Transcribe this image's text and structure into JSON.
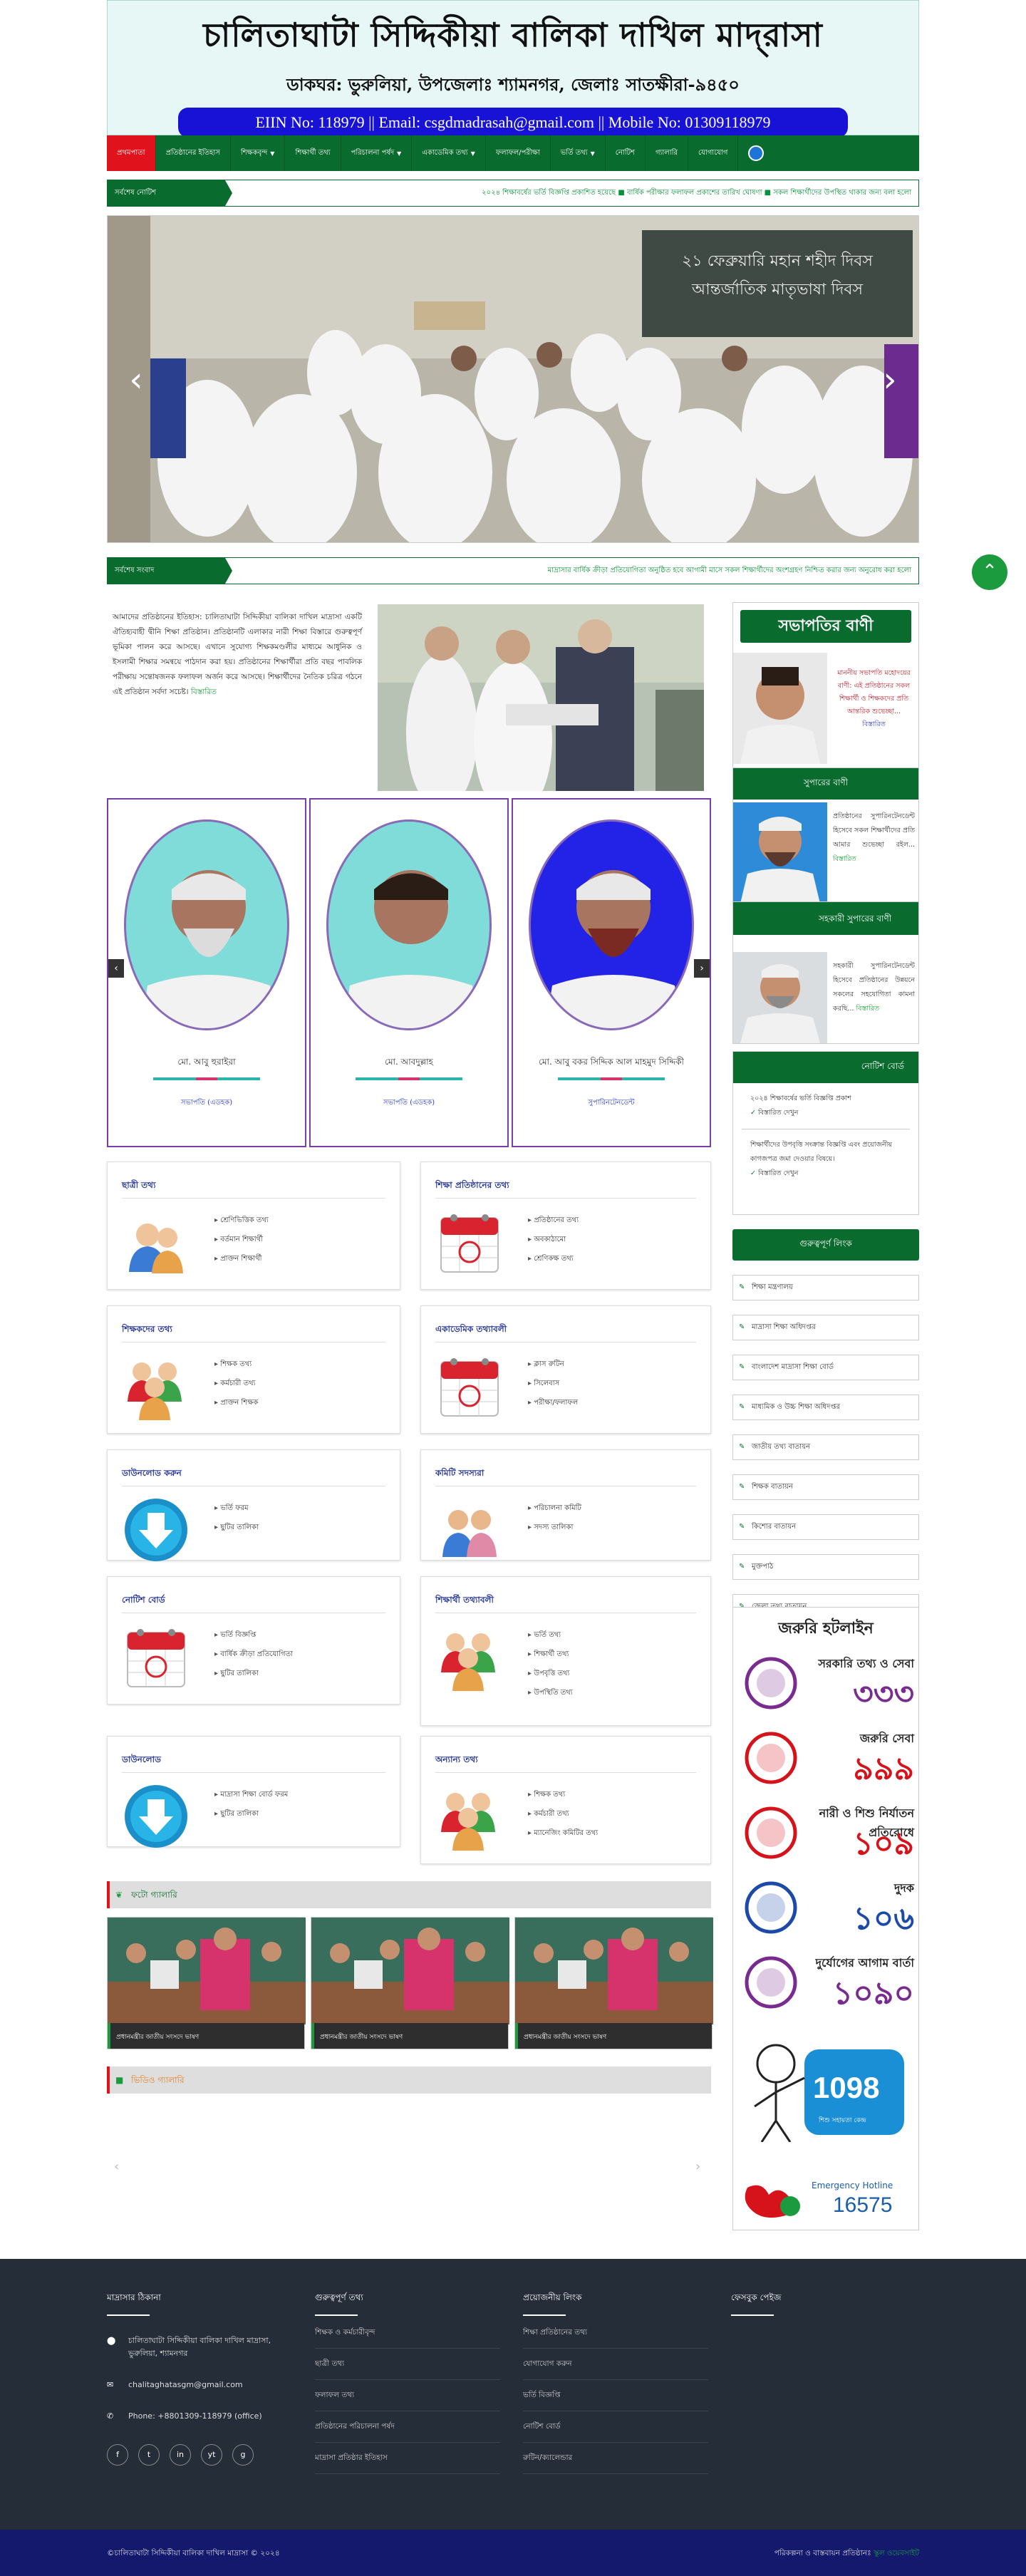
{
  "header": {
    "title": "চালিতাঘাটা সিদ্দিকীয়া বালিকা দাখিল মাদ্‌রাসা",
    "address": "ডাকঘর: ভুরুলিয়া, উপজেলাঃ শ্যামনগর, জেলাঃ সাতক্ষীরা-৯৪৫০",
    "contact": "EIIN No: 118979 || Email: csgdmadrasah@gmail.com || Mobile No: 01309118979"
  },
  "nav": {
    "items": [
      {
        "label": "প্রথমপাতা",
        "active": true,
        "caret": false
      },
      {
        "label": "প্রতিষ্ঠানের ইতিহাস",
        "active": false,
        "caret": false
      },
      {
        "label": "শিক্ষকবৃন্দ",
        "active": false,
        "caret": true
      },
      {
        "label": "শিক্ষার্থী তথ্য",
        "active": false,
        "caret": false
      },
      {
        "label": "পরিচালনা পর্ষদ",
        "active": false,
        "caret": true
      },
      {
        "label": "একাডেমিক তথ্য",
        "active": false,
        "caret": true
      },
      {
        "label": "ফলাফল/পরীক্ষা",
        "active": false,
        "caret": false
      },
      {
        "label": "ভর্তি তথ্য",
        "active": false,
        "caret": true
      },
      {
        "label": "নোটিশ",
        "active": false,
        "caret": false
      },
      {
        "label": "গ্যালারি",
        "active": false,
        "caret": false
      },
      {
        "label": "যোগাযোগ",
        "active": false,
        "caret": false
      }
    ]
  },
  "ticker1": {
    "label": "সর্বশেষ নোটিশ",
    "text": "২০২৪ শিক্ষাবর্ষের ভর্তি বিজ্ঞপ্তি প্রকাশিত হয়েছে ■ বার্ষিক পরীক্ষার ফলাফল প্রকাশের তারিখ ঘোষণা ■ সকল শিক্ষার্থীদের উপস্থিত থাকার জন্য বলা হলো"
  },
  "slider": {
    "banner_line1": "২১ ফেব্রুয়ারি মহান শহীদ দিবস",
    "banner_line2": "আন্তর্জাতিক মাতৃভাষা দিবস"
  },
  "ticker2": {
    "label": "সর্বশেষ সংবাদ",
    "text": "মাদ্রাসার বার্ষিক ক্রীড়া প্রতিযোগিতা অনুষ্ঠিত হবে আগামী মাসে সকল শিক্ষার্থীদের অংশগ্রহণ নিশ্চিত করার জন্য অনুরোধ করা হলো"
  },
  "about": {
    "text": "আমাদের প্রতিষ্ঠানের ইতিহাস: চালিতাঘাটা সিদ্দিকীয়া বালিকা দাখিল মাদ্রাসা একটি ঐতিহ্যবাহী দ্বীনি শিক্ষা প্রতিষ্ঠান। প্রতিষ্ঠানটি এলাকার নারী শিক্ষা বিস্তারে গুরুত্বপূর্ণ ভূমিকা পালন করে আসছে। এখানে সুযোগ্য শিক্ষকমণ্ডলীর মাধ্যমে আধুনিক ও ইসলামী শিক্ষার সমন্বয়ে পাঠদান করা হয়। প্রতিষ্ঠানের শিক্ষার্থীরা প্রতি বছর পাবলিক পরীক্ষায় সন্তোষজনক ফলাফল অর্জন করে আসছে। শিক্ষার্থীদের নৈতিক চরিত্র গঠনে এই প্রতিষ্ঠান সর্বদা সচেষ্ট।",
    "more": "বিস্তারিত"
  },
  "staff": [
    {
      "name": "মো. আবু হুরাইরা",
      "role": "সভাপতি (এডহক)",
      "bg": "#7fdcd8"
    },
    {
      "name": "মো. আবদুল্লাহ",
      "role": "সভাপতি (এডহক)",
      "bg": "#7fdcd8"
    },
    {
      "name": "মো. আবু বকর সিদ্দিক আল মাহমুদ সিদ্দিকী",
      "role": "সুপারিনটেনডেন্ট",
      "bg": "#2323e8"
    }
  ],
  "boxes": [
    {
      "title": "ছাত্রী তথ্য",
      "icon": "users-icon",
      "items": [
        "শ্রেণিভিত্তিক তথ্য",
        "বর্তমান শিক্ষার্থী",
        "প্রাক্তন শিক্ষার্থী"
      ]
    },
    {
      "title": "শিক্ষা প্রতিষ্ঠানের তথ্য",
      "icon": "calendar-icon",
      "items": [
        "প্রতিষ্ঠানের তথ্য",
        "অবকাঠামো",
        "শ্রেণিকক্ষ তথ্য"
      ]
    },
    {
      "title": "শিক্ষকদের তথ্য",
      "icon": "group-icon",
      "items": [
        "শিক্ষক তথ্য",
        "কর্মচারী তথ্য",
        "প্রাক্তন শিক্ষক"
      ]
    },
    {
      "title": "একাডেমিক তথ্যাবলী",
      "icon": "calendar-icon",
      "items": [
        "ক্লাস রুটিন",
        "সিলেবাস",
        "পরীক্ষা/ফলাফল"
      ]
    },
    {
      "title": "ডাউনলোড করুন",
      "icon": "download-icon",
      "items": [
        "ভর্তি ফরম",
        "ছুটির তালিকা"
      ]
    },
    {
      "title": "কমিটি সদস্যরা",
      "icon": "pair-icon",
      "items": [
        "পরিচালনা কমিটি",
        "সদস্য তালিকা"
      ]
    },
    {
      "title": "নোটিশ বোর্ড",
      "icon": "calendar-icon",
      "items": [
        "ভর্তি বিজ্ঞপ্তি",
        "বার্ষিক ক্রীড়া প্রতিযোগিতা",
        "ছুটির তালিকা"
      ]
    },
    {
      "title": "শিক্ষার্থী তথ্যাবলী",
      "icon": "group-icon",
      "items": [
        "ভর্তি তথ্য",
        "শিক্ষার্থী তথ্য",
        "উপবৃত্তি তথ্য",
        "উপস্থিতি তথ্য"
      ]
    },
    {
      "title": "ডাউনলোড",
      "icon": "download-icon",
      "items": [
        "মাদ্রাসা শিক্ষা বোর্ড ফরম",
        "ছুটির তালিকা"
      ]
    },
    {
      "title": "অন্যান্য তথ্য",
      "icon": "group-icon",
      "items": [
        "শিক্ষক তথ্য",
        "কর্মচারী তথ্য",
        "ম্যানেজিং কমিটির তথ্য"
      ]
    }
  ],
  "sidebar": {
    "message_title": "সভাপতির বাণী",
    "message_text": "মাননীয় সভাপতি মহোদয়ের বাণী: এই প্রতিষ্ঠানের সকল শিক্ষার্থী ও শিক্ষকদের প্রতি আন্তরিক শুভেচ্ছা...",
    "message_more": "বিস্তারিত",
    "head2": "সুপারের বাণী",
    "text2": "প্রতিষ্ঠানের সুপারিনটেনডেন্ট হিসেবে সকল শিক্ষার্থীদের প্রতি আমার শুভেচ্ছা রইল...",
    "more2": "বিস্তারিত",
    "head3": "সহকারী সুপারের বাণী",
    "text3": "সহকারী সুপারিনটেনডেন্ট হিসেবে প্রতিষ্ঠানের উন্নয়নে সকলের সহযোগিতা কামনা করছি...",
    "more3": "বিস্তারিত",
    "notice_head": "নোটিশ বোর্ড",
    "notice1": "২০২৪ শিক্ষাবর্ষের ভর্তি বিজ্ঞপ্তি প্রকাশ",
    "notice2": "শিক্ষার্থীদের উপবৃত্তি সংক্রান্ত বিজ্ঞপ্তি এবং প্রয়োজনীয় কাগজপত্র জমা দেওয়ার বিষয়ে।",
    "notice_tag1": "বিস্তারিত দেখুন",
    "notice_tag2": "বিস্তারিত দেখুন",
    "links_head": "গুরুত্বপূর্ণ লিংক",
    "links": [
      "শিক্ষা মন্ত্রণালয়",
      "মাদ্রাসা শিক্ষা অধিদপ্তর",
      "বাংলাদেশ মাদ্রাসা শিক্ষা বোর্ড",
      "মাধ্যমিক ও উচ্চ শিক্ষা অধিদপ্তর",
      "জাতীয় তথ্য বাতায়ন",
      "শিক্ষক বাতায়ন",
      "কিশোর বাতায়ন",
      "মুক্তপাঠ",
      "জেলা তথ্য বাতায়ন"
    ],
    "hotline_head": "জরুরি হটলাইন",
    "hotlines": [
      {
        "num": "৩৩৩",
        "label": "সরকারি তথ্য ও সেবা",
        "color": "#7a2b8f"
      },
      {
        "num": "৯৯৯",
        "label": "জরুরি সেবা",
        "color": "#d6121b"
      },
      {
        "num": "১০৯",
        "label": "নারী ও শিশু নির্যাতন প্রতিরোধে",
        "color": "#d6121b"
      },
      {
        "num": "১০৬",
        "label": "দুদক",
        "color": "#1d4aa8"
      },
      {
        "num": "১০৯০",
        "label": "দুর্যোগের আগাম বার্তা",
        "color": "#7a2b8f"
      }
    ],
    "child_help": "1098",
    "child_help_label": "শিশু সহায়তা কেন্দ্র",
    "emergency_label": "Emergency Hotline",
    "emergency_num": "16575"
  },
  "videos_head": "ফটো গ্যালারি",
  "videos": [
    {
      "caption": "প্রধানমন্ত্রীর জাতীয় সংসদে ভাষণ"
    },
    {
      "caption": "প্রধানমন্ত্রীর জাতীয় সংসদে ভাষণ"
    },
    {
      "caption": "প্রধানমন্ত্রীর জাতীয় সংসদে ভাষণ"
    }
  ],
  "video_head2": "ভিডিও গ্যালারি",
  "footer": {
    "col1_head": "মাদ্রাসার ঠিকানা",
    "address": "চালিতাঘাটা সিদ্দিকীয়া বালিকা দাখিল মাদ্রাসা, ভুরুলিয়া, শ্যামনগর",
    "email": "chalitaghatasgm@gmail.com",
    "phone": "Phone: +8801309-118979 (office)",
    "col2_head": "গুরুত্বপূর্ণ তথ্য",
    "col2": [
      "শিক্ষক ও কর্মচারীবৃন্দ",
      "ছাত্রী তথ্য",
      "ফলাফল তথ্য",
      "প্রতিষ্ঠানের পরিচালনা পর্ষদ",
      "মাদ্রাসা প্রতিষ্ঠার ইতিহাস"
    ],
    "col3_head": "প্রয়োজনীয় লিংক",
    "col3": [
      "শিক্ষা প্রতিষ্ঠানের তথ্য",
      "যোগাযোগ করুন",
      "ভর্তি বিজ্ঞপ্তি",
      "নোটিশ বোর্ড",
      "রুটিন/ক্যালেন্ডার"
    ],
    "col4_head": "ফেসবুক পেইজ",
    "social": [
      "f",
      "t",
      "in",
      "yt",
      "g"
    ]
  },
  "copyright": {
    "left": "©চালিতাঘাটা সিদ্দিকীয়া বালিকা দাখিল মাদ্রাসা © ২০২৪",
    "right_prefix": "পরিকল্পনা ও বাস্তবায়ন প্রতিষ্ঠানঃ",
    "right_link": "স্কুল ওয়েবসাইট"
  }
}
